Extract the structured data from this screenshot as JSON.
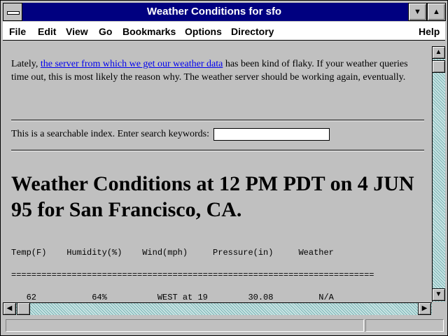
{
  "window": {
    "title": "Weather Conditions for sfo"
  },
  "controls": {
    "minimize": "▼",
    "maximize": "▲"
  },
  "menu": {
    "file": "File",
    "edit": "Edit",
    "view": "View",
    "go": "Go",
    "bookmarks": "Bookmarks",
    "options": "Options",
    "directory": "Directory",
    "help": "Help"
  },
  "notice": {
    "before": "Lately, ",
    "link": "the server from which we get our weather data",
    "after": " has been kind of flaky. If your weather queries time out, this is most likely the reason why. The weather server should be working again, eventually."
  },
  "search": {
    "label": "This is a searchable index. Enter search keywords:",
    "value": ""
  },
  "headline": "Weather Conditions at 12 PM PDT on 4 JUN 95 for San Francisco, CA.",
  "table": {
    "header": "Temp(F)    Humidity(%)    Wind(mph)     Pressure(in)     Weather",
    "separator": "========================================================================",
    "row": "   62           64%          WEST at 19        30.08         N/A"
  },
  "scrollbars": {
    "up": "▲",
    "down": "▼",
    "left": "◀",
    "right": "▶"
  },
  "status": {
    "text": ""
  }
}
